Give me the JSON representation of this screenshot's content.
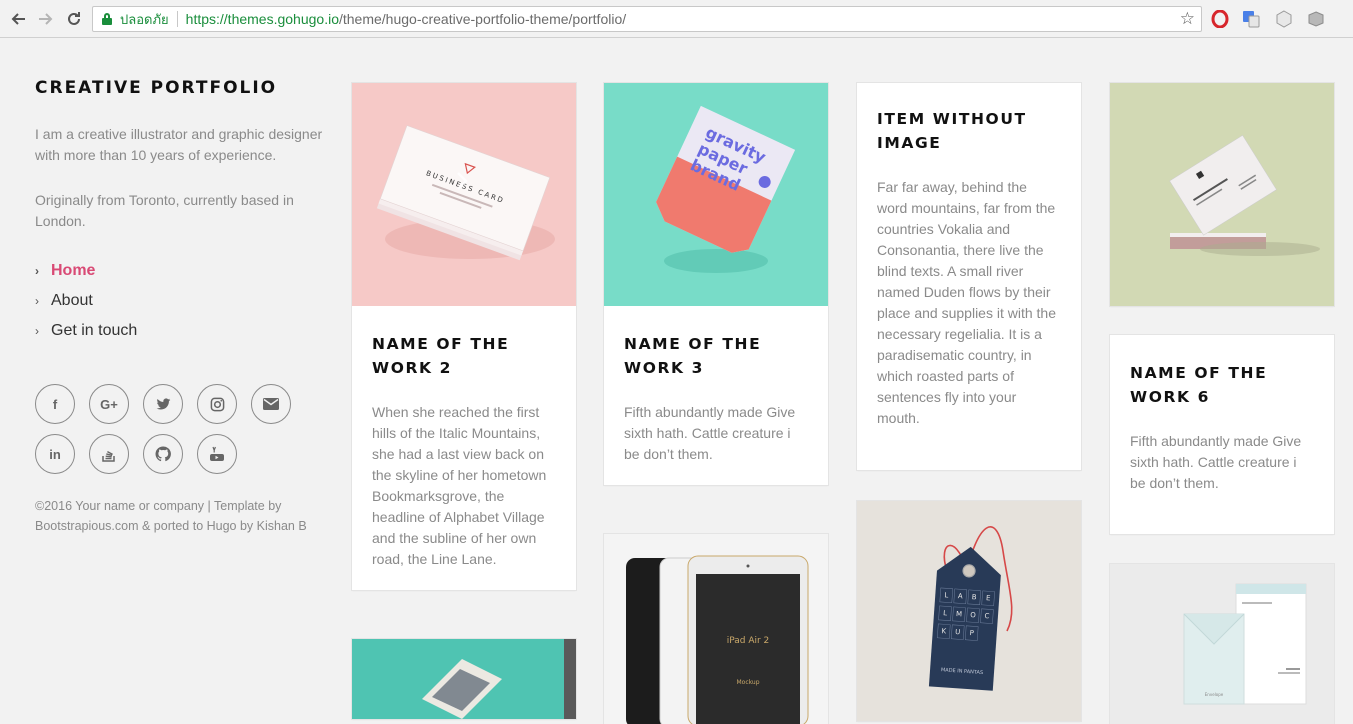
{
  "browser": {
    "secure_label": "ปลอดภัย",
    "url_host": "https://themes.gohugo.io",
    "url_path": "/theme/hugo-creative-portfolio-theme/portfolio/"
  },
  "sidebar": {
    "title": "CREATIVE PORTFOLIO",
    "bio1": "I am a creative illustrator and graphic designer with more than 10 years of experience.",
    "bio2": "Originally from Toronto, currently based in London.",
    "menu": [
      {
        "label": "Home",
        "active": true
      },
      {
        "label": "About"
      },
      {
        "label": "Get in touch"
      }
    ],
    "social_glyphs": {
      "facebook": "f",
      "googleplus": "G+",
      "linkedin": "in"
    },
    "copyright": "©2016 Your name or company | Template by Bootstrapious.com & ported to Hugo by Kishan B"
  },
  "cards": {
    "work2": {
      "title": "NAME OF THE WORK 2",
      "text": "When she reached the first hills of the Italic Mountains, she had a last view back on the skyline of her hometown Bookmarksgrove, the headline of Alphabet Village and the subline of her own road, the Line Lane.",
      "image_bg": "#f6c9c7",
      "image_text": "BUSINESS CARD"
    },
    "work3": {
      "title": "NAME OF THE WORK 3",
      "text": "Fifth abundantly made Give sixth hath. Cattle creature i be don’t them.",
      "image_bg": "#78dcc8",
      "image_text1": "gravity",
      "image_text2": "paper",
      "image_text3": "brand"
    },
    "noimage": {
      "title": "ITEM WITHOUT IMAGE",
      "text": "Far far away, behind the word mountains, far from the countries Vokalia and Consonantia, there live the blind texts. A small river named Duden flows by their place and supplies it with the necessary regelialia. It is a paradisematic country, in which roasted parts of sentences fly into your mouth."
    },
    "work6": {
      "title": "NAME OF THE WORK 6",
      "text": "Fifth abundantly made Give sixth hath. Cattle creature i be don’t them.",
      "image_bg": "#d2d9b4"
    },
    "ipad": {
      "device_label": "iPad Air 2",
      "mockup_label": "Mockup"
    },
    "tag": {
      "letters": [
        "L",
        "A",
        "B",
        "E",
        "L",
        "M",
        "O",
        "C",
        "K",
        "U",
        "P"
      ],
      "caption": "MADE IN PANTAS"
    },
    "envelope": {
      "label": "Envelope"
    }
  },
  "colors": {
    "accent": "#d94a75",
    "secure_green": "#1a8e3c",
    "page_bg": "#f2f2f2",
    "muted_text": "#8a8a8a"
  }
}
